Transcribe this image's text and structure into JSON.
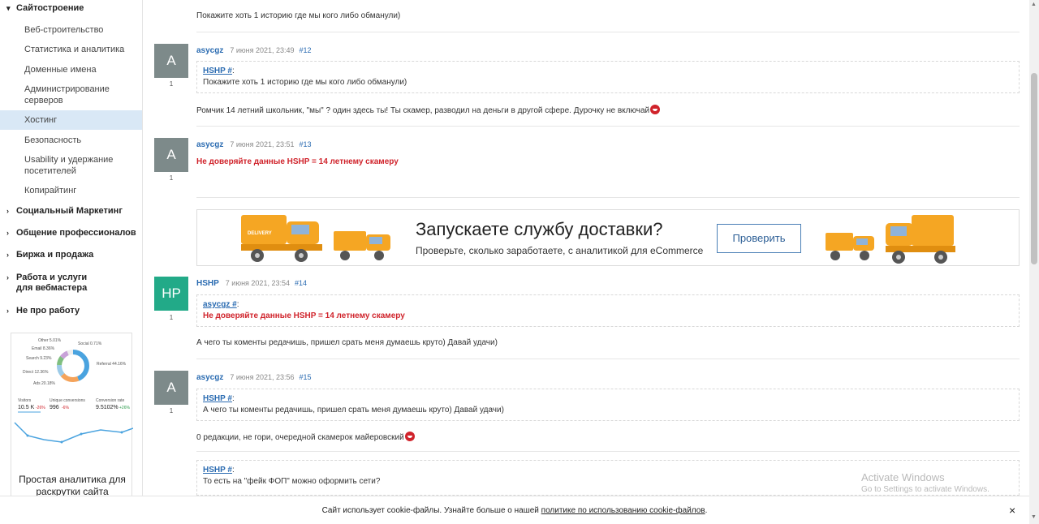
{
  "sidebar": {
    "category_top": "Сайтостроение",
    "subs": [
      "Веб-строительство",
      "Статистика и аналитика",
      "Доменные имена",
      "Администрирование серверов",
      "Хостинг",
      "Безопасность",
      "Usability и удержание посетителей",
      "Копирайтинг"
    ],
    "categories": [
      "Социальный Маркетинг",
      "Общение профессионалов",
      "Биржа и продажа",
      "Работа и услуги для вебмастера",
      "Не про работу"
    ],
    "ad": {
      "pie_labels": [
        "Other 5.01%",
        "Social 0.71%",
        "Email 8.36%",
        "Search 9.23%",
        "Referral 44.16%",
        "Direct 12.36%",
        "Ads 20.18%"
      ],
      "stats": [
        {
          "label": "Visitors",
          "value": "10.5 K",
          "delta": "-26%"
        },
        {
          "label": "Unique conversions",
          "value": "996",
          "delta": "-6%"
        },
        {
          "label": "Conversion rate",
          "value": "9.5102%",
          "delta": "+26%"
        }
      ],
      "caption": "Простая аналитика для раскрутки сайта"
    }
  },
  "top_fragment": "Покажите хоть 1 историю где мы кого либо обманули)",
  "posts": [
    {
      "avatar": "A",
      "votes": "1",
      "author": "asycgz",
      "date": "7 июня 2021, 23:49",
      "num": "#12",
      "quote_author": "HSHP #",
      "quote_text": "Покажите хоть 1 историю где мы кого либо обманули)",
      "text": "Ромчик 14 летний школьник, \"мы\" ? один здесь ты! Ты скамер, разводил на деньги в другой сфере. Дурочку не включай"
    },
    {
      "avatar": "A",
      "votes": "1",
      "author": "asycgz",
      "date": "7 июня 2021, 23:51",
      "num": "#13",
      "text": "Не доверяйте данные HSHP =  14 летнему скамеру"
    },
    {
      "avatar": "HP",
      "votes": "1",
      "author": "HSHP",
      "date": "7 июня 2021, 23:54",
      "num": "#14",
      "quote_author": "asycgz #",
      "quote_text": "Не доверяйте данные HSHP =  14 летнему скамеру",
      "text": "А чего ты коменты редачишь, пришел срать меня думаешь круто) Давай удачи)"
    },
    {
      "avatar": "A",
      "votes": "1",
      "author": "asycgz",
      "date": "7 июня 2021, 23:56",
      "num": "#15",
      "quote_author": "HSHP #",
      "quote_text": "А чего ты коменты редачишь, пришел срать меня думаешь круто) Давай удачи)",
      "text": "0 редакции, не гори, очередной скамерок майеровский"
    }
  ],
  "last_quote": {
    "author": "HSHP #",
    "text": "То есть на \"фейк ФОП\" можно оформить сети?"
  },
  "banner": {
    "title": "Запускаете службу доставки?",
    "subtitle": "Проверьте, сколько заработаете, с аналитикой для eCommerce",
    "button": "Проверить",
    "truck_text": "DELIVERY"
  },
  "cookie": {
    "text": "Сайт использует cookie-файлы. Узнайте больше о нашей",
    "link": "политике по использованию cookie-файлов",
    "end": ".",
    "close": "×"
  },
  "watermark": {
    "line1": "Activate Windows",
    "line2": "Go to Settings to activate Windows."
  },
  "colors": {
    "accent": "#2a6bb1",
    "red": "#d0232b",
    "avatar_grey": "#7d8a8a",
    "avatar_teal": "#22aa88",
    "active_bg": "#d9e8f6"
  }
}
